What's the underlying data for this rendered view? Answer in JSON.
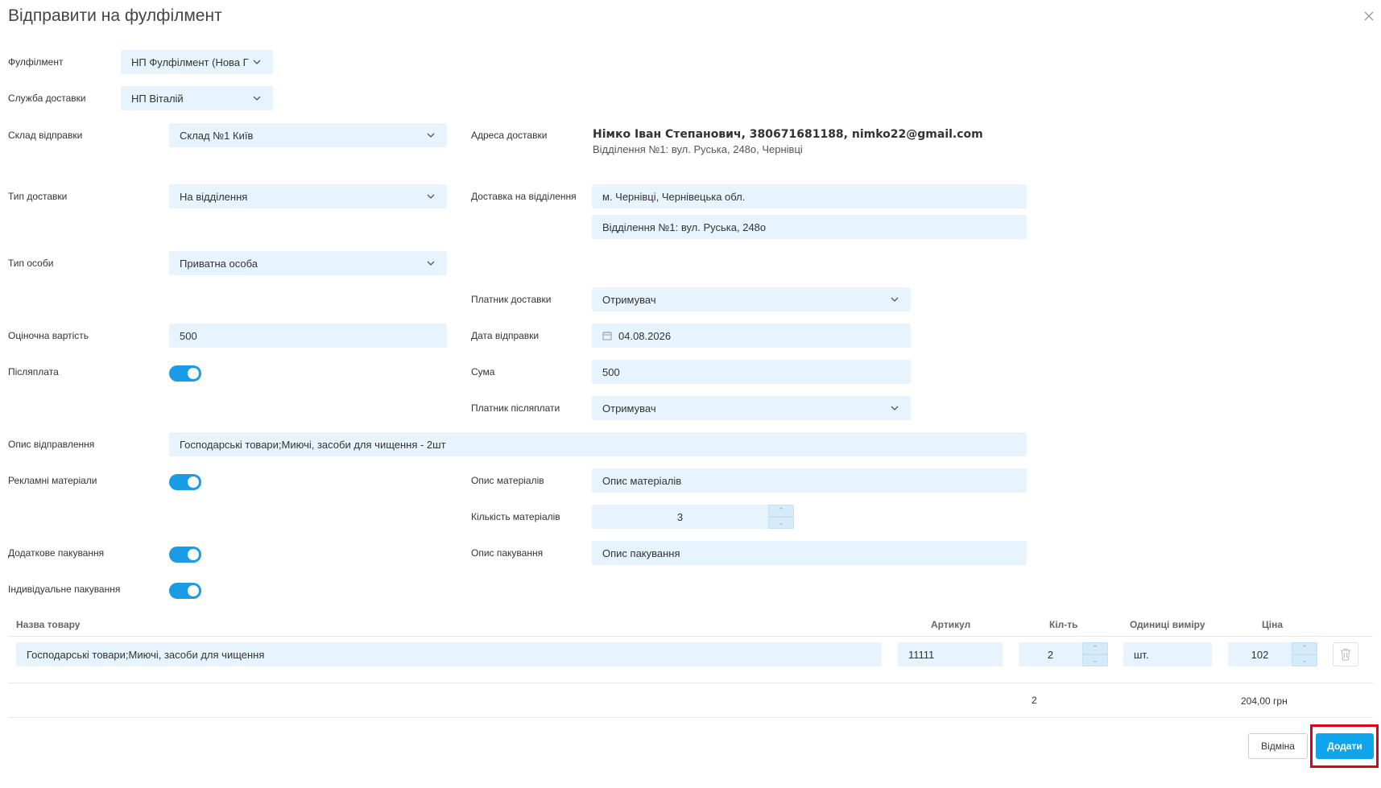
{
  "dialog": {
    "title": "Відправити на фулфілмент"
  },
  "form": {
    "fulfillment": {
      "label": "Фулфілмент",
      "value": "НП Фулфілмент (Нова Г"
    },
    "delivery_service": {
      "label": "Служба доставки",
      "value": "НП Віталій"
    },
    "warehouse": {
      "label": "Склад відправки",
      "value": "Склад №1 Київ"
    },
    "delivery_type": {
      "label": "Тип доставки",
      "value": "На відділення"
    },
    "person_type": {
      "label": "Тип особи",
      "value": "Приватна особа"
    },
    "estimated_value": {
      "label": "Оціночна вартість",
      "value": "500"
    },
    "cod": {
      "label": "Післяплата",
      "enabled": true
    },
    "description": {
      "label": "Опис відправлення",
      "value": "Господарські товари;Миючі, засоби для чищення - 2шт"
    },
    "ad_materials": {
      "label": "Рекламні матеріали",
      "enabled": true
    },
    "extra_packaging": {
      "label": "Додаткове пакування",
      "enabled": true
    },
    "individual_packaging": {
      "label": "Індивідуальне пакування",
      "enabled": true
    },
    "delivery_address": {
      "label": "Адреса доставки",
      "name_line": "Німко Іван Степанович, 380671681188, nimko22@gmail.com",
      "branch_line": "Відділення №1: вул. Руська, 248о, Чернівці"
    },
    "branch_delivery": {
      "label": "Доставка на відділення",
      "city": "м. Чернівці, Чернівецька обл.",
      "branch": "Відділення №1: вул. Руська, 248о"
    },
    "delivery_payer": {
      "label": "Платник доставки",
      "value": "Отримувач"
    },
    "ship_date": {
      "label": "Дата відправки",
      "value": "04.08.2026"
    },
    "sum": {
      "label": "Сума",
      "value": "500"
    },
    "cod_payer": {
      "label": "Платник післяплати",
      "value": "Отримувач"
    },
    "materials_description": {
      "label": "Опис матеріалів",
      "placeholder": "Опис матеріалів"
    },
    "materials_qty": {
      "label": "Кількість матеріалів",
      "value": "3"
    },
    "packaging_description": {
      "label": "Опис пакування",
      "placeholder": "Опис пакування"
    }
  },
  "table": {
    "headers": {
      "name": "Назва товару",
      "sku": "Артикул",
      "qty": "Кіл-ть",
      "unit": "Одиниці виміру",
      "price": "Ціна"
    },
    "rows": [
      {
        "name": "Господарські товари;Миючі, засоби для чищення",
        "sku": "11111",
        "qty": "2",
        "unit": "шт.",
        "price": "102"
      }
    ],
    "totals": {
      "qty": "2",
      "sum": "204,00 грн"
    }
  },
  "buttons": {
    "cancel": "Відміна",
    "add": "Додати"
  },
  "icons": {
    "close": "close-icon",
    "chevron": "chevron-down-icon",
    "calendar": "calendar-icon",
    "trash": "trash-icon"
  },
  "colors": {
    "accent": "#1a9be6",
    "field_bg": "#e8f4fd",
    "highlight": "#e0001a"
  }
}
